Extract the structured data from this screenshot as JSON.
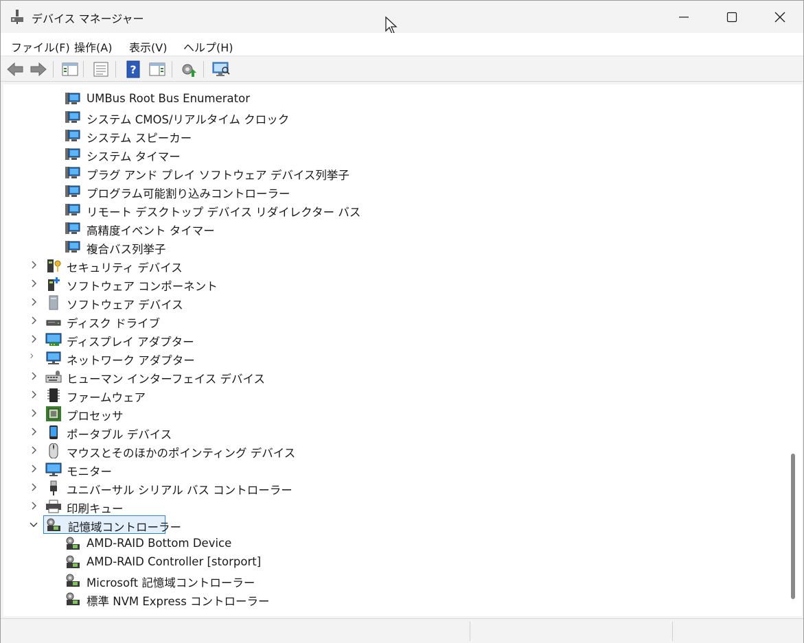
{
  "window": {
    "title": "デバイス マネージャー"
  },
  "menu": [
    {
      "label": "ファイル(F)"
    },
    {
      "label": "操作(A)"
    },
    {
      "label": "表示(V)"
    },
    {
      "label": "ヘルプ(H)"
    }
  ],
  "toolbar": {
    "buttons": [
      "back-arrow-icon",
      "forward-arrow-icon",
      "show-hide-console-tree-icon",
      "properties-icon",
      "help-icon",
      "action-pane-icon",
      "update-driver-icon",
      "scan-hardware-icon"
    ]
  },
  "tree": {
    "system_children": [
      {
        "label": "UMBus Root Bus Enumerator"
      },
      {
        "label": "システム CMOS/リアルタイム クロック"
      },
      {
        "label": "システム スピーカー"
      },
      {
        "label": "システム タイマー"
      },
      {
        "label": "プラグ アンド プレイ ソフトウェア デバイス列挙子"
      },
      {
        "label": "プログラム可能割り込みコントローラー"
      },
      {
        "label": "リモート デスクトップ デバイス リダイレクター バス"
      },
      {
        "label": "高精度イベント タイマー"
      },
      {
        "label": "複合バス列挙子"
      }
    ],
    "categories": [
      {
        "label": "セキュリティ デバイス",
        "icon": "security-device-icon"
      },
      {
        "label": "ソフトウェア コンポーネント",
        "icon": "software-component-icon"
      },
      {
        "label": "ソフトウェア デバイス",
        "icon": "software-device-icon"
      },
      {
        "label": "ディスク ドライブ",
        "icon": "disk-drive-icon"
      },
      {
        "label": "ディスプレイ アダプター",
        "icon": "display-adapter-icon"
      },
      {
        "label": "ネットワーク アダプター",
        "icon": "network-adapter-icon"
      },
      {
        "label": "ヒューマン インターフェイス デバイス",
        "icon": "hid-icon"
      },
      {
        "label": "ファームウェア",
        "icon": "firmware-icon"
      },
      {
        "label": "プロセッサ",
        "icon": "processor-icon"
      },
      {
        "label": "ポータブル デバイス",
        "icon": "portable-device-icon"
      },
      {
        "label": "マウスとそのほかのポインティング デバイス",
        "icon": "mouse-icon"
      },
      {
        "label": "モニター",
        "icon": "monitor-icon"
      },
      {
        "label": "ユニバーサル シリアル バス コントローラー",
        "icon": "usb-icon"
      },
      {
        "label": "印刷キュー",
        "icon": "printer-icon"
      }
    ],
    "expanded_category": {
      "label": "記憶域コントローラー",
      "icon": "storage-controller-icon"
    },
    "storage_children": [
      {
        "label": "AMD-RAID Bottom Device"
      },
      {
        "label": "AMD-RAID Controller [storport]"
      },
      {
        "label": "Microsoft 記憶域コントローラー"
      },
      {
        "label": "標準 NVM Express コントローラー"
      }
    ]
  }
}
